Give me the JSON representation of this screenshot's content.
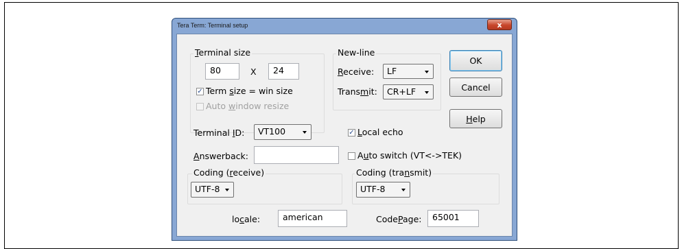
{
  "window": {
    "title": "Tera Term: Terminal setup",
    "close_label": "x"
  },
  "terminal_size": {
    "label_pre": "",
    "label_ul": "T",
    "label_post": "erminal size",
    "cols": "80",
    "times": "X",
    "rows": "24",
    "term_size_pre": "Term ",
    "term_size_ul": "s",
    "term_size_post": "ize = win size",
    "term_size_checked": true,
    "auto_resize_pre": "Auto ",
    "auto_resize_ul": "w",
    "auto_resize_post": "indow resize",
    "auto_resize_checked": false
  },
  "newline": {
    "label": "New-line",
    "receive_pre": "",
    "receive_ul": "R",
    "receive_post": "eceive:",
    "receive_value": "LF",
    "transmit_pre": "Trans",
    "transmit_ul": "m",
    "transmit_post": "it:",
    "transmit_value": "CR+LF"
  },
  "buttons": {
    "ok": "OK",
    "cancel": "Cancel",
    "help_pre": "",
    "help_ul": "H",
    "help_post": "elp"
  },
  "terminal_id": {
    "pre": "Terminal ",
    "ul": "I",
    "post": "D:",
    "value": "VT100"
  },
  "local_echo": {
    "pre": "",
    "ul": "L",
    "post": "ocal echo",
    "checked": true
  },
  "answerback": {
    "pre": "",
    "ul": "A",
    "post": "nswerback:",
    "value": ""
  },
  "auto_switch": {
    "pre": "A",
    "ul": "u",
    "post": "to switch (VT<->TEK)",
    "checked": false
  },
  "coding_receive": {
    "pre": "Coding (",
    "ul": "r",
    "post": "eceive)",
    "value": "UTF-8"
  },
  "coding_transmit": {
    "pre": "Coding (tra",
    "ul": "n",
    "post": "smit)",
    "value": "UTF-8"
  },
  "locale": {
    "pre": "lo",
    "ul": "c",
    "post": "ale:",
    "value": "american"
  },
  "codepage": {
    "pre": "Code",
    "ul": "P",
    "post": "age:",
    "value": "65001"
  }
}
